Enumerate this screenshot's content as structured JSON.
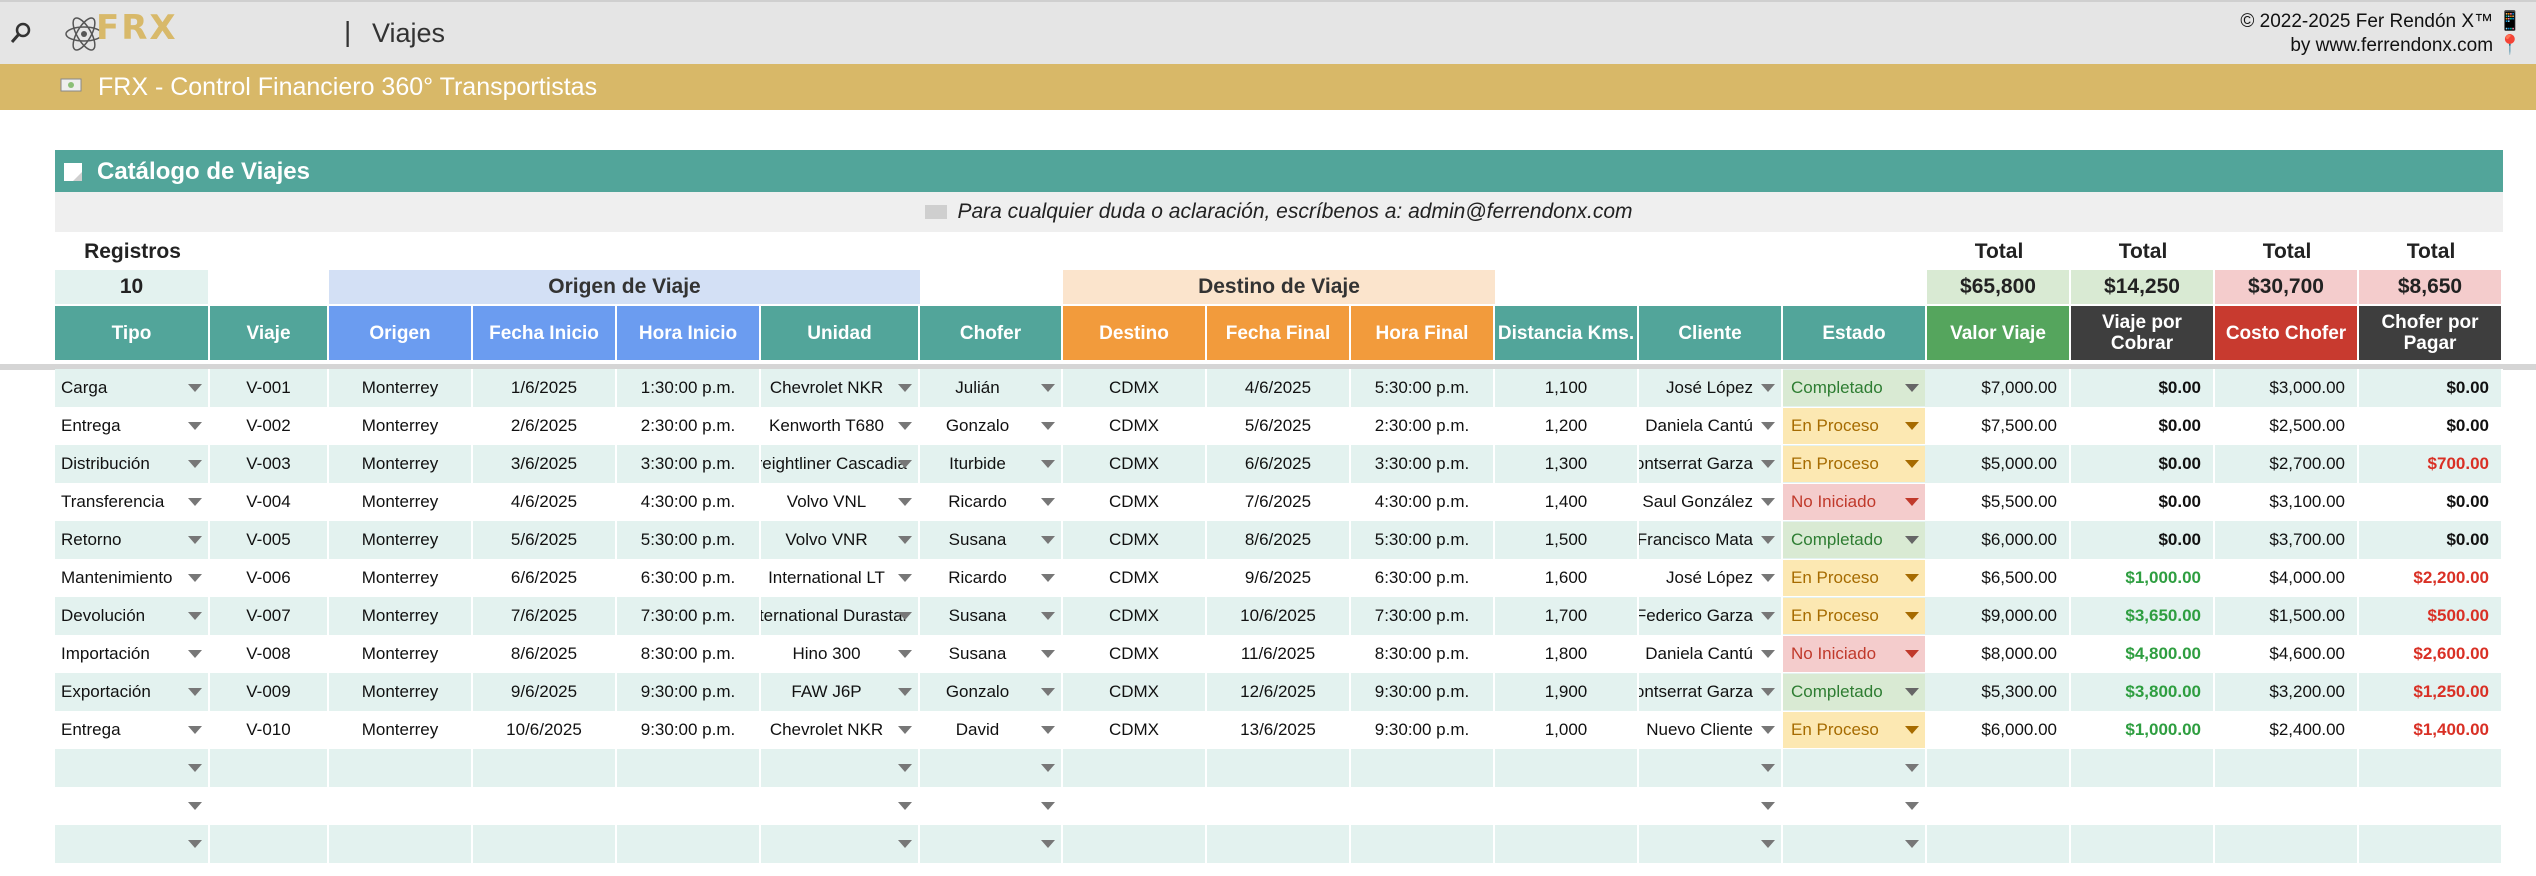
{
  "app": {
    "logo_text": "FRX",
    "page_separator": "|",
    "page_name": "Viajes",
    "copyright_line1": "© 2022-2025 Fer Rendón X™ 📱",
    "copyright_line2": "by www.ferrendonx.com 📍"
  },
  "banner": {
    "title": "FRX - Control Financiero 360° Transportistas"
  },
  "catalog": {
    "title": "Catálogo de Viajes",
    "contact": "Para cualquier duda o aclaración, escríbenos a: admin@ferrendonx.com"
  },
  "summary": {
    "registros_label": "Registros",
    "registros_value": "10",
    "origen_group": "Origen de Viaje",
    "destino_group": "Destino de Viaje",
    "total_label": "Total",
    "totals": [
      "$65,800",
      "$14,250",
      "$30,700",
      "$8,650"
    ]
  },
  "columns": [
    "Tipo",
    "Viaje",
    "Origen",
    "Fecha Inicio",
    "Hora Inicio",
    "Unidad",
    "Chofer",
    "Destino",
    "Fecha Final",
    "Hora Final",
    "Distancia Kms.",
    "Cliente",
    "Estado",
    "Valor Viaje",
    "Viaje por Cobrar",
    "Costo Chofer",
    "Chofer por Pagar"
  ],
  "rows": [
    [
      "Carga",
      "V-001",
      "Monterrey",
      "1/6/2025",
      "1:30:00 p.m.",
      "Chevrolet NKR",
      "Julián",
      "CDMX",
      "4/6/2025",
      "5:30:00 p.m.",
      "1,100",
      "José López",
      "Completado",
      "$7,000.00",
      "$0.00",
      "$3,000.00",
      "$0.00"
    ],
    [
      "Entrega",
      "V-002",
      "Monterrey",
      "2/6/2025",
      "2:30:00 p.m.",
      "Kenworth T680",
      "Gonzalo",
      "CDMX",
      "5/6/2025",
      "2:30:00 p.m.",
      "1,200",
      "Daniela Cantú",
      "En Proceso",
      "$7,500.00",
      "$0.00",
      "$2,500.00",
      "$0.00"
    ],
    [
      "Distribución",
      "V-003",
      "Monterrey",
      "3/6/2025",
      "3:30:00 p.m.",
      "Freightliner Cascadia",
      "Iturbide",
      "CDMX",
      "6/6/2025",
      "3:30:00 p.m.",
      "1,300",
      "Montserrat Garza",
      "En Proceso",
      "$5,000.00",
      "$0.00",
      "$2,700.00",
      "$700.00"
    ],
    [
      "Transferencia",
      "V-004",
      "Monterrey",
      "4/6/2025",
      "4:30:00 p.m.",
      "Volvo VNL",
      "Ricardo",
      "CDMX",
      "7/6/2025",
      "4:30:00 p.m.",
      "1,400",
      "Saul González",
      "No Iniciado",
      "$5,500.00",
      "$0.00",
      "$3,100.00",
      "$0.00"
    ],
    [
      "Retorno",
      "V-005",
      "Monterrey",
      "5/6/2025",
      "5:30:00 p.m.",
      "Volvo VNR",
      "Susana",
      "CDMX",
      "8/6/2025",
      "5:30:00 p.m.",
      "1,500",
      "Francisco Mata",
      "Completado",
      "$6,000.00",
      "$0.00",
      "$3,700.00",
      "$0.00"
    ],
    [
      "Mantenimiento",
      "V-006",
      "Monterrey",
      "6/6/2025",
      "6:30:00 p.m.",
      "International LT",
      "Ricardo",
      "CDMX",
      "9/6/2025",
      "6:30:00 p.m.",
      "1,600",
      "José López",
      "En Proceso",
      "$6,500.00",
      "$1,000.00",
      "$4,000.00",
      "$2,200.00"
    ],
    [
      "Devolución",
      "V-007",
      "Monterrey",
      "7/6/2025",
      "7:30:00 p.m.",
      "International Durastar",
      "Susana",
      "CDMX",
      "10/6/2025",
      "7:30:00 p.m.",
      "1,700",
      "Federico Garza",
      "En Proceso",
      "$9,000.00",
      "$3,650.00",
      "$1,500.00",
      "$500.00"
    ],
    [
      "Importación",
      "V-008",
      "Monterrey",
      "8/6/2025",
      "8:30:00 p.m.",
      "Hino 300",
      "Susana",
      "CDMX",
      "11/6/2025",
      "8:30:00 p.m.",
      "1,800",
      "Daniela Cantú",
      "No Iniciado",
      "$8,000.00",
      "$4,800.00",
      "$4,600.00",
      "$2,600.00"
    ],
    [
      "Exportación",
      "V-009",
      "Monterrey",
      "9/6/2025",
      "9:30:00 p.m.",
      "FAW J6P",
      "Gonzalo",
      "CDMX",
      "12/6/2025",
      "9:30:00 p.m.",
      "1,900",
      "Montserrat Garza",
      "Completado",
      "$5,300.00",
      "$3,800.00",
      "$3,200.00",
      "$1,250.00"
    ],
    [
      "Entrega",
      "V-010",
      "Monterrey",
      "10/6/2025",
      "9:30:00 p.m.",
      "Chevrolet NKR",
      "David",
      "CDMX",
      "13/6/2025",
      "9:30:00 p.m.",
      "1,000",
      "Nuevo Cliente",
      "En Proceso",
      "$6,000.00",
      "$1,000.00",
      "$2,400.00",
      "$1,400.00"
    ]
  ],
  "colors": {
    "teal_header": "#52a59a",
    "blue_header": "#6b9cf0",
    "orange_header": "#f29b3c",
    "green_header": "#55a55d",
    "dark_header": "#3e3e3e",
    "red_header": "#c83a2f",
    "row_alt": "#e3f2ef",
    "status_completado": "#d9ead3",
    "status_en_proceso": "#fce8b2",
    "status_no_iniciado": "#f4cccc",
    "money_green": "#2e9e40",
    "money_red": "#d93025"
  }
}
